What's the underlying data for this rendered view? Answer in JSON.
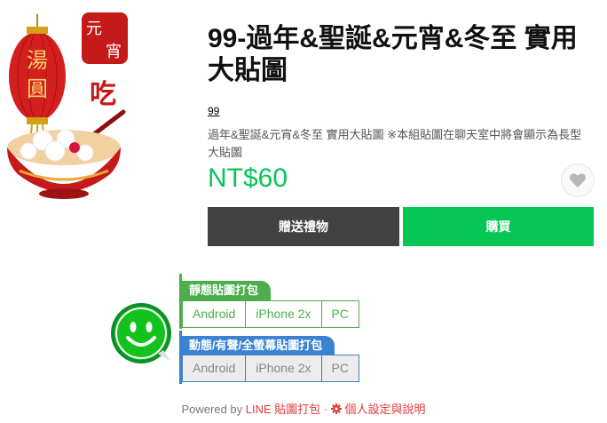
{
  "product": {
    "title": "99-過年&聖誕&元宵&冬至 實用大貼圖",
    "author": "99",
    "description": "過年&聖誕&元宵&冬至 實用大貼圖 ※本組貼圖在聊天室中將會顯示為長型大貼圖",
    "price": "NT$60",
    "image_text": {
      "lantern_chars": [
        "湯",
        "圓"
      ],
      "badge_chars": [
        "元",
        "宵"
      ],
      "eat_char": "吃"
    }
  },
  "actions": {
    "gift_label": "贈送禮物",
    "buy_label": "購買"
  },
  "tool": {
    "static_label": "靜態貼圖打包",
    "static_options": [
      "Android",
      "iPhone 2x",
      "PC"
    ],
    "animated_label": "動態/有聲/全螢幕貼圖打包",
    "animated_options": [
      "Android",
      "iPhone 2x",
      "PC"
    ]
  },
  "footer": {
    "powered_by": "Powered by",
    "tool_link": "LINE 貼圖打包",
    "separator": "·",
    "settings_link": "個人設定與說明"
  },
  "colors": {
    "brand_green": "#06c755",
    "tag_green": "#4cae4c",
    "tag_blue": "#3b82d0",
    "gift_button": "#424242",
    "link_red": "#e4393c"
  },
  "icons": [
    "heart-icon",
    "smiley-icon",
    "gear-icon"
  ]
}
